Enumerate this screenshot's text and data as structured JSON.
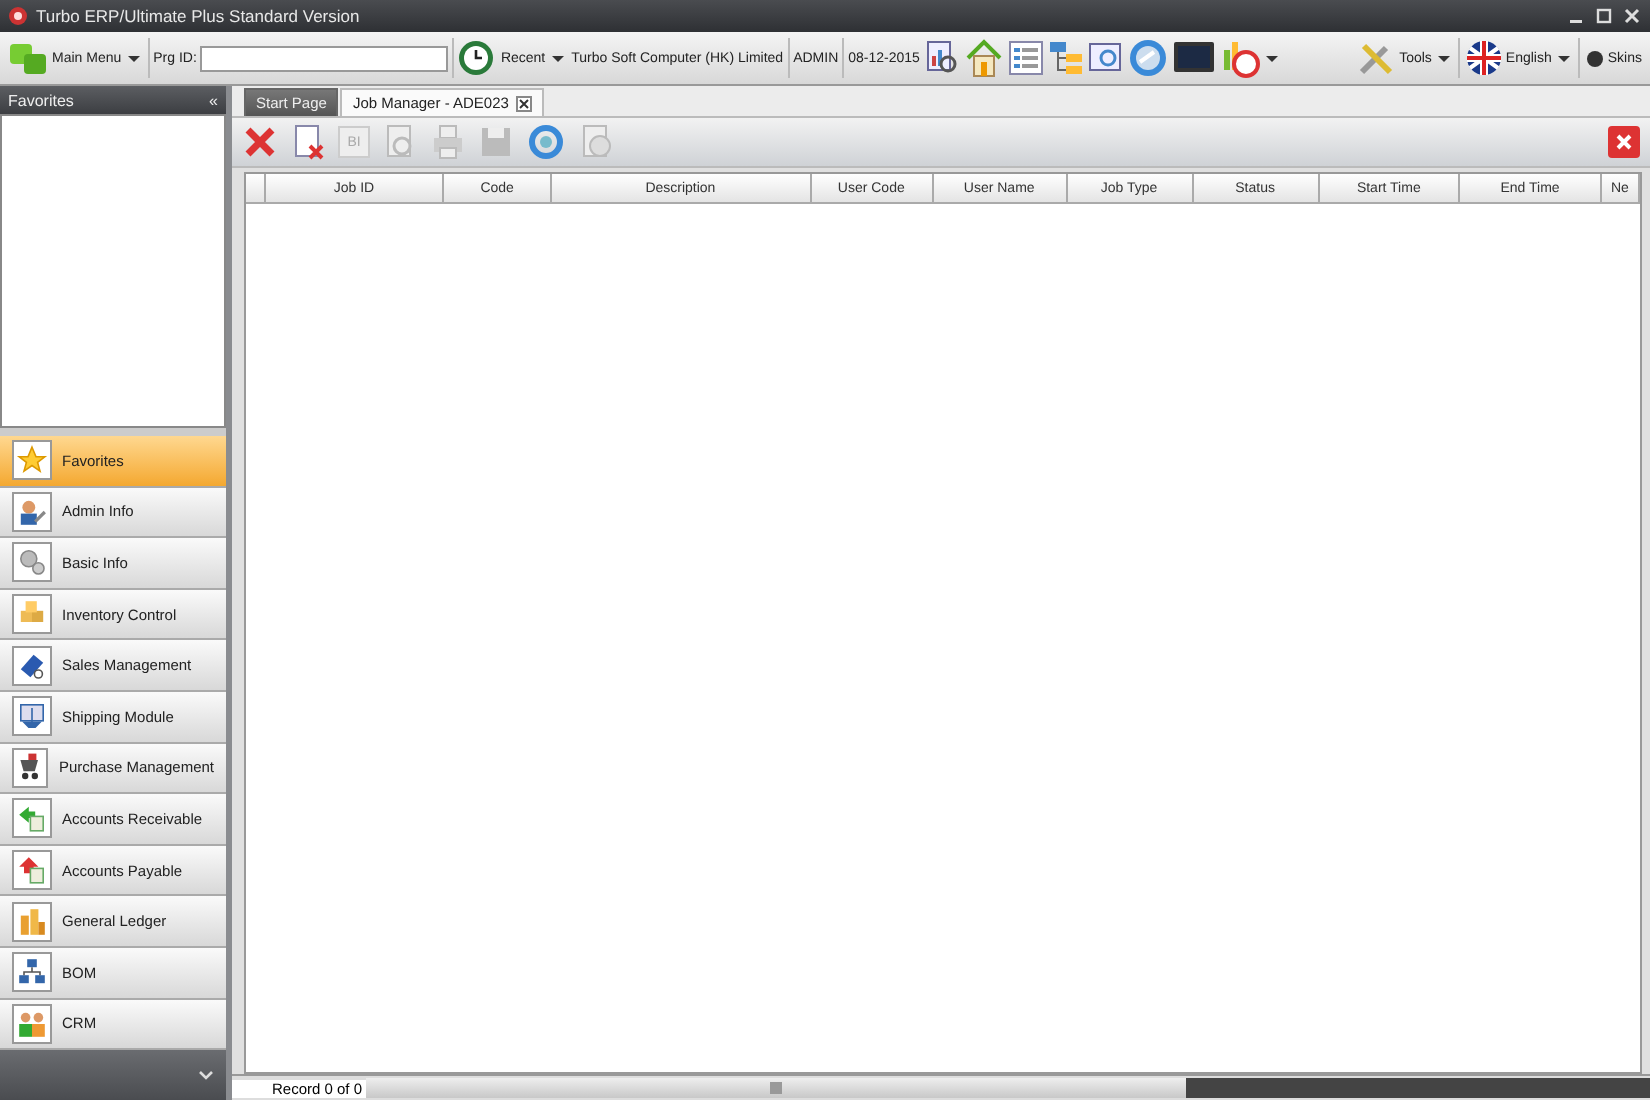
{
  "window": {
    "title": "Turbo ERP/Ultimate Plus Standard Version"
  },
  "toolbar": {
    "main_menu": "Main Menu",
    "prg_id_label": "Prg ID:",
    "recent": "Recent",
    "company": "Turbo Soft Computer (HK) Limited",
    "user": "ADMIN",
    "date": "08-12-2015",
    "tools": "Tools",
    "language": "English",
    "skins": "Skins"
  },
  "sidebar": {
    "title": "Favorites",
    "collapse": "«",
    "items": [
      {
        "label": "Favorites",
        "selected": true
      },
      {
        "label": "Admin Info",
        "selected": false
      },
      {
        "label": "Basic Info",
        "selected": false
      },
      {
        "label": "Inventory Control",
        "selected": false
      },
      {
        "label": "Sales Management",
        "selected": false
      },
      {
        "label": "Shipping Module",
        "selected": false
      },
      {
        "label": "Purchase Management",
        "selected": false
      },
      {
        "label": "Accounts Receivable",
        "selected": false
      },
      {
        "label": "Accounts Payable",
        "selected": false
      },
      {
        "label": "General Ledger",
        "selected": false
      },
      {
        "label": "BOM",
        "selected": false
      },
      {
        "label": "CRM",
        "selected": false
      }
    ]
  },
  "tabs": [
    {
      "label": "Start Page",
      "selected": false,
      "closable": false
    },
    {
      "label": "Job Manager - ADE023",
      "selected": true,
      "closable": true
    }
  ],
  "bi_button": "BI",
  "table": {
    "columns": [
      "Job ID",
      "Code",
      "Description",
      "User Code",
      "User Name",
      "Job Type",
      "Status",
      "Start Time",
      "End Time",
      "Ne"
    ]
  },
  "status_bar": {
    "record": "Record 0 of 0"
  }
}
